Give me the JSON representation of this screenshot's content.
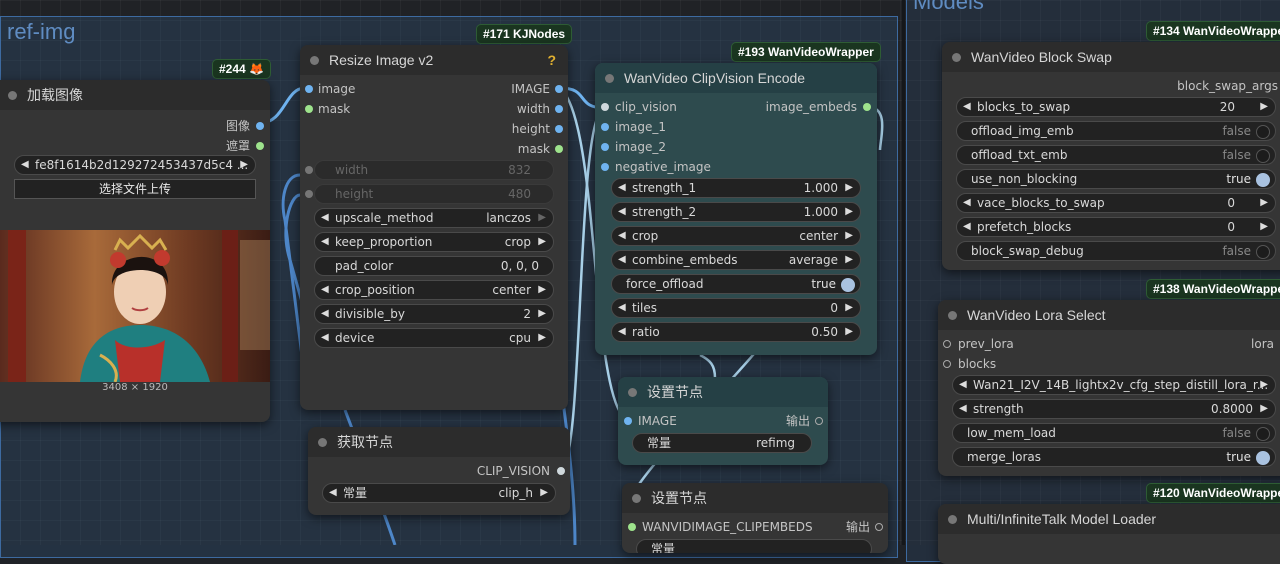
{
  "groups": {
    "ref_img": "ref-img",
    "models": "Models"
  },
  "colors": {
    "canvas": "#202226",
    "group_fill": "#345c8a",
    "node_body": "#353535",
    "node_teal": "#2e4b4e",
    "badge_bg": "#1a3520",
    "socket_image": "#6fb3f0",
    "socket_mask": "#9ee38c",
    "help_icon": "#e0b030"
  },
  "load_image": {
    "badge": "#244",
    "badge_icon": "fox-icon",
    "title": "加载图像",
    "outputs": [
      "图像",
      "遮罩"
    ],
    "file": "fe8f1614b2d129272453437d5c4 ...",
    "upload_button": "选择文件上传",
    "image_size": "3408 × 1920"
  },
  "resize_image": {
    "badge": "#171 KJNodes",
    "title": "Resize Image v2",
    "help": "?",
    "inputs": [
      "image",
      "mask"
    ],
    "outputs": [
      "IMAGE",
      "width",
      "height",
      "mask"
    ],
    "widgets": [
      {
        "label": "width",
        "value": "832",
        "dim": true
      },
      {
        "label": "height",
        "value": "480",
        "dim": true
      },
      {
        "label": "upscale_method",
        "value": "lanczos"
      },
      {
        "label": "keep_proportion",
        "value": "crop"
      },
      {
        "label": "pad_color",
        "value": "0, 0, 0"
      },
      {
        "label": "crop_position",
        "value": "center"
      },
      {
        "label": "divisible_by",
        "value": "2"
      },
      {
        "label": "device",
        "value": "cpu"
      }
    ]
  },
  "clipvision_encode": {
    "badge": "#193 WanVideoWrapper",
    "title": "WanVideo ClipVision Encode",
    "inputs": [
      "clip_vision",
      "image_1",
      "image_2",
      "negative_image"
    ],
    "output": "image_embeds",
    "widgets": [
      {
        "label": "strength_1",
        "value": "1.000"
      },
      {
        "label": "strength_2",
        "value": "1.000"
      },
      {
        "label": "crop",
        "value": "center"
      },
      {
        "label": "combine_embeds",
        "value": "average"
      },
      {
        "label": "force_offload",
        "value": "true",
        "toggle": true
      },
      {
        "label": "tiles",
        "value": "0"
      },
      {
        "label": "ratio",
        "value": "0.50"
      }
    ]
  },
  "get_node": {
    "title": "获取节点",
    "output": "CLIP_VISION",
    "widget_label": "常量",
    "widget_value": "clip_h"
  },
  "set_node_1": {
    "title": "设置节点",
    "input": "IMAGE",
    "output": "输出",
    "widget_label": "常量",
    "widget_value": "refimg"
  },
  "set_node_2": {
    "title": "设置节点",
    "input": "WANVIDIMAGE_CLIPEMBEDS",
    "output": "输出",
    "widget_label": "常量"
  },
  "block_swap": {
    "badge": "#134 WanVideoWrappe",
    "title": "WanVideo Block Swap",
    "output": "block_swap_args",
    "widgets": [
      {
        "label": "blocks_to_swap",
        "value": "20",
        "type": "num"
      },
      {
        "label": "offload_img_emb",
        "value": "false",
        "type": "toggle",
        "on": false
      },
      {
        "label": "offload_txt_emb",
        "value": "false",
        "type": "toggle",
        "on": false
      },
      {
        "label": "use_non_blocking",
        "value": "true",
        "type": "toggle",
        "on": true
      },
      {
        "label": "vace_blocks_to_swap",
        "value": "0",
        "type": "num"
      },
      {
        "label": "prefetch_blocks",
        "value": "0",
        "type": "num"
      },
      {
        "label": "block_swap_debug",
        "value": "false",
        "type": "toggle",
        "on": false
      }
    ]
  },
  "lora_select": {
    "badge": "#138 WanVideoWrappe",
    "title": "WanVideo Lora Select",
    "help": "?",
    "inputs": [
      "prev_lora",
      "blocks"
    ],
    "output": "lora",
    "lora_file": "Wan21_I2V_14B_lightx2v_cfg_step_distill_lora_r...",
    "widgets": [
      {
        "label": "strength",
        "value": "0.8000",
        "type": "num"
      },
      {
        "label": "low_mem_load",
        "value": "false",
        "type": "toggle",
        "on": false
      },
      {
        "label": "merge_loras",
        "value": "true",
        "type": "toggle",
        "on": true
      }
    ]
  },
  "multitalk_loader": {
    "badge": "#120 WanVideoWrappe",
    "title": "Multi/InfiniteTalk Model Loader"
  }
}
